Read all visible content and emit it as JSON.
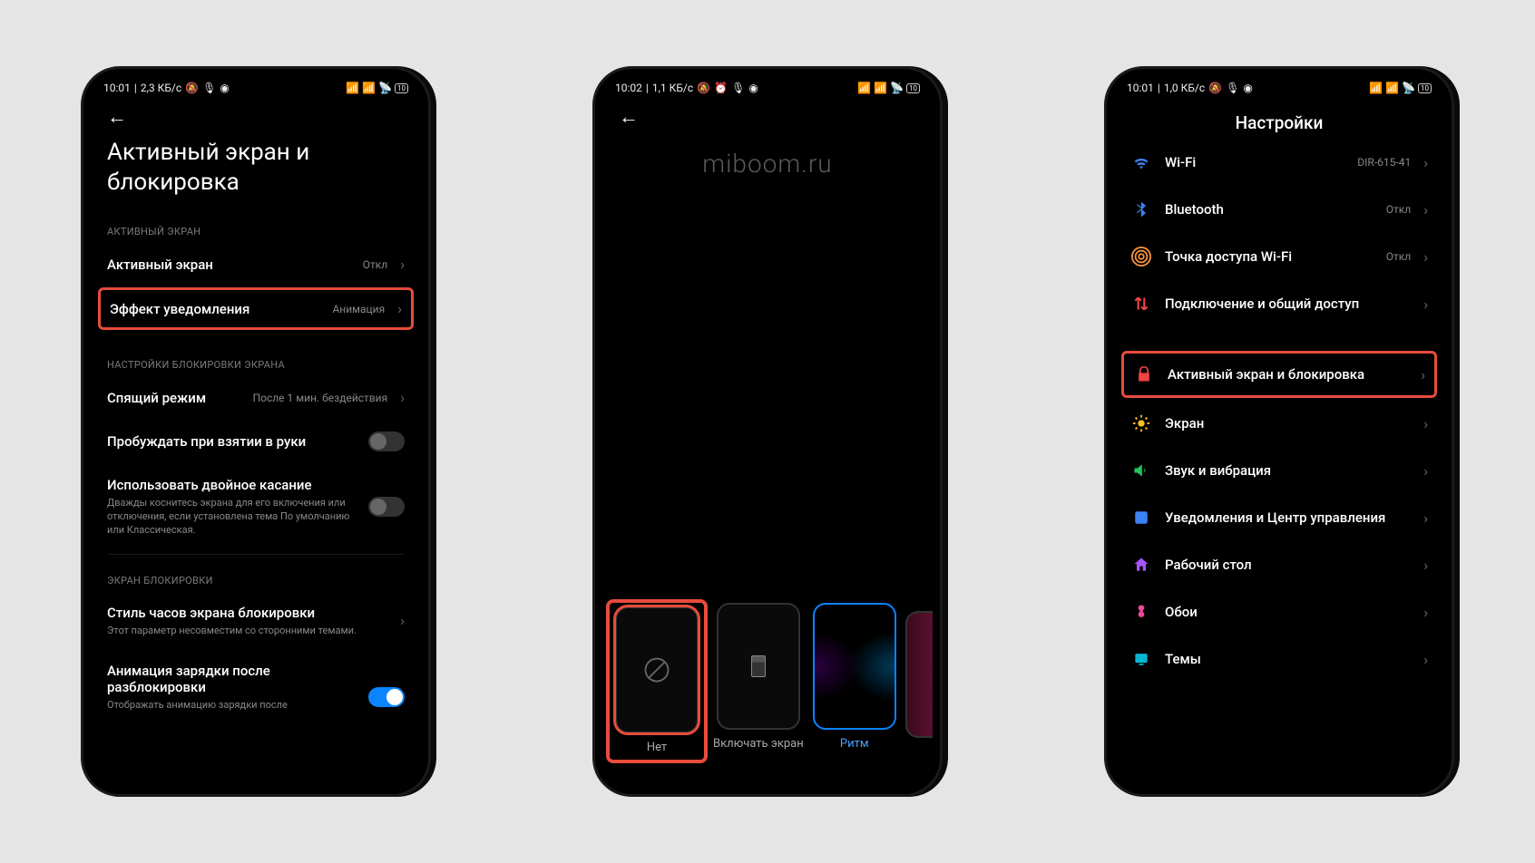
{
  "watermark": "miboom.ru",
  "phone1": {
    "status": {
      "time": "10:01",
      "net": "2,3 КБ/с"
    },
    "title": "Активный экран и блокировка",
    "section1": "АКТИВНЫЙ ЭКРАН",
    "row_active": {
      "label": "Активный экран",
      "value": "Откл"
    },
    "row_effect": {
      "label": "Эффект уведомления",
      "value": "Анимация"
    },
    "section2": "НАСТРОЙКИ БЛОКИРОВКИ ЭКРАНА",
    "row_sleep": {
      "label": "Спящий режим",
      "value": "После 1 мин. бездействия"
    },
    "row_wake": {
      "label": "Пробуждать при взятии в руки"
    },
    "row_dtap": {
      "label": "Использовать двойное касание",
      "sub": "Дважды коснитесь экрана для его включения или отключения, если установлена тема По умолчанию или Классическая."
    },
    "section3": "ЭКРАН БЛОКИРОВКИ",
    "row_clock": {
      "label": "Стиль часов экрана блокировки",
      "sub": "Этот параметр несовместим со сторонними темами."
    },
    "row_charge": {
      "label": "Анимация зарядки после разблокировки",
      "sub": "Отображать анимацию зарядки после"
    }
  },
  "phone2": {
    "status": {
      "time": "10:02",
      "net": "1,1 КБ/с"
    },
    "options": [
      {
        "label": "Нет"
      },
      {
        "label": "Включать экран"
      },
      {
        "label": "Ритм"
      }
    ]
  },
  "phone3": {
    "status": {
      "time": "10:01",
      "net": "1,0 КБ/с"
    },
    "title": "Настройки",
    "rows": {
      "wifi": {
        "label": "Wi-Fi",
        "value": "DIR-615-41"
      },
      "bt": {
        "label": "Bluetooth",
        "value": "Откл"
      },
      "hotspot": {
        "label": "Точка доступа Wi-Fi",
        "value": "Откл"
      },
      "share": {
        "label": "Подключение и общий доступ"
      },
      "lock": {
        "label": "Активный экран и блокировка"
      },
      "display": {
        "label": "Экран"
      },
      "sound": {
        "label": "Звук и вибрация"
      },
      "notif": {
        "label": "Уведомления и Центр управления"
      },
      "home": {
        "label": "Рабочий стол"
      },
      "wall": {
        "label": "Обои"
      },
      "theme": {
        "label": "Темы"
      }
    }
  }
}
